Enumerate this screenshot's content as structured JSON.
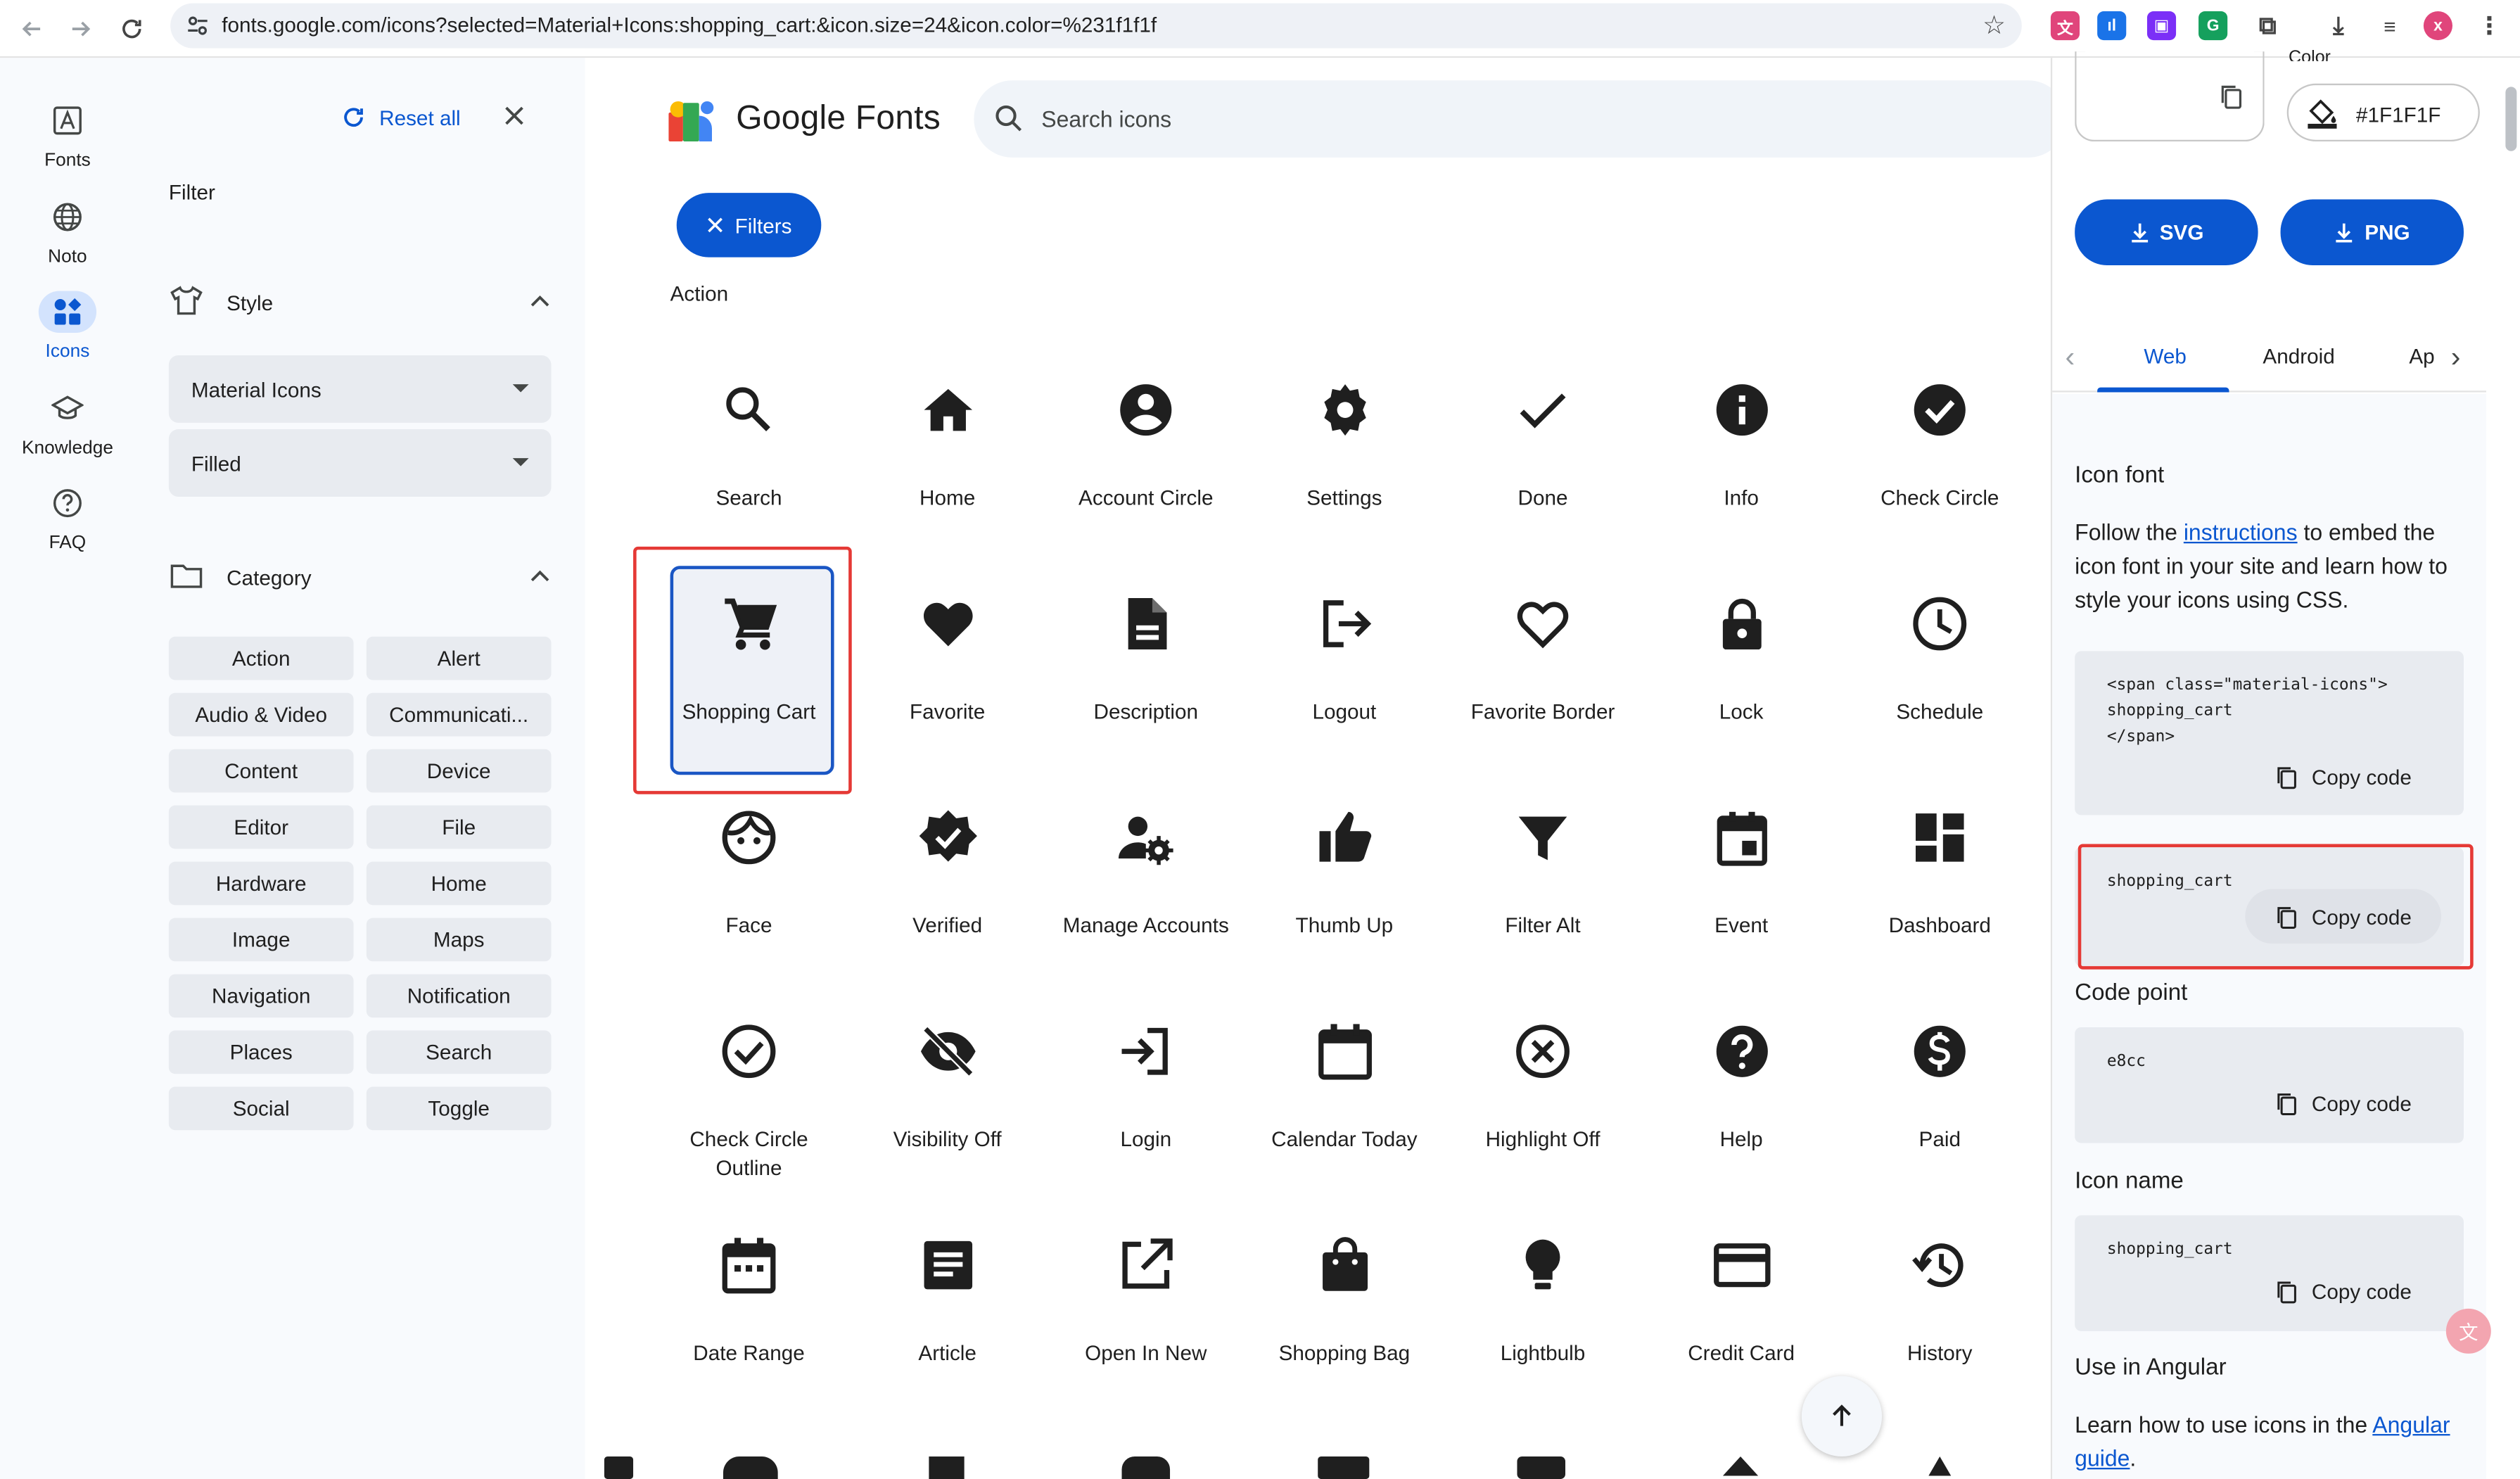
{
  "browser": {
    "url": "fonts.google.com/icons?selected=Material+Icons:shopping_cart:&icon.size=24&icon.color=%231f1f1f",
    "extensions": [
      {
        "name": "translate-extension-icon",
        "color": "#e0457b",
        "glyph": "文"
      },
      {
        "name": "analytics-extension-icon",
        "color": "#1a73e8",
        "glyph": "ıl"
      },
      {
        "name": "twitch-extension-icon",
        "color": "#7b2ff7",
        "glyph": "▣"
      },
      {
        "name": "grammarly-extension-icon",
        "color": "#15a05d",
        "glyph": "G"
      }
    ],
    "profile_initial": "x"
  },
  "rail": {
    "items": [
      {
        "label": "Fonts",
        "icon": "fonts-icon"
      },
      {
        "label": "Noto",
        "icon": "globe-icon"
      },
      {
        "label": "Icons",
        "icon": "icons-icon",
        "active": true
      },
      {
        "label": "Knowledge",
        "icon": "graduation-cap-icon"
      },
      {
        "label": "FAQ",
        "icon": "help-circle-icon"
      }
    ]
  },
  "filter": {
    "reset_label": "Reset all",
    "title": "Filter",
    "style_heading": "Style",
    "style_select": "Material Icons",
    "variant_select": "Filled",
    "category_heading": "Category",
    "categories": [
      "Action",
      "Alert",
      "Audio & Video",
      "Communicati...",
      "Content",
      "Device",
      "Editor",
      "File",
      "Hardware",
      "Home",
      "Image",
      "Maps",
      "Navigation",
      "Notification",
      "Places",
      "Search",
      "Social",
      "Toggle"
    ]
  },
  "main": {
    "brand": "Google Fonts",
    "search_placeholder": "Search icons",
    "filters_label": "Filters",
    "category_title": "Action",
    "icons": [
      {
        "label": "Search",
        "icon": "search"
      },
      {
        "label": "Home",
        "icon": "home"
      },
      {
        "label": "Account Circle",
        "icon": "account_circle"
      },
      {
        "label": "Settings",
        "icon": "settings"
      },
      {
        "label": "Done",
        "icon": "done"
      },
      {
        "label": "Info",
        "icon": "info"
      },
      {
        "label": "Check Circle",
        "icon": "check_circle"
      },
      {
        "label": "Shopping Cart",
        "icon": "shopping_cart",
        "selected": true
      },
      {
        "label": "Favorite",
        "icon": "favorite"
      },
      {
        "label": "Description",
        "icon": "description"
      },
      {
        "label": "Logout",
        "icon": "logout"
      },
      {
        "label": "Favorite Border",
        "icon": "favorite_border"
      },
      {
        "label": "Lock",
        "icon": "lock"
      },
      {
        "label": "Schedule",
        "icon": "schedule"
      },
      {
        "label": "Face",
        "icon": "face"
      },
      {
        "label": "Verified",
        "icon": "verified"
      },
      {
        "label": "Manage Accounts",
        "icon": "manage_accounts"
      },
      {
        "label": "Thumb Up",
        "icon": "thumb_up"
      },
      {
        "label": "Filter Alt",
        "icon": "filter_alt"
      },
      {
        "label": "Event",
        "icon": "event"
      },
      {
        "label": "Dashboard",
        "icon": "dashboard"
      },
      {
        "label": "Check Circle Outline",
        "icon": "check_circle_outline"
      },
      {
        "label": "Visibility Off",
        "icon": "visibility_off"
      },
      {
        "label": "Login",
        "icon": "login"
      },
      {
        "label": "Calendar Today",
        "icon": "calendar_today"
      },
      {
        "label": "Highlight Off",
        "icon": "highlight_off"
      },
      {
        "label": "Help",
        "icon": "help"
      },
      {
        "label": "Paid",
        "icon": "paid"
      },
      {
        "label": "Date Range",
        "icon": "date_range"
      },
      {
        "label": "Article",
        "icon": "article"
      },
      {
        "label": "Open In New",
        "icon": "open_in_new"
      },
      {
        "label": "Shopping Bag",
        "icon": "shopping_bag"
      },
      {
        "label": "Lightbulb",
        "icon": "lightbulb"
      },
      {
        "label": "Credit Card",
        "icon": "credit_card"
      },
      {
        "label": "History",
        "icon": "history"
      }
    ]
  },
  "panel": {
    "color_label": "Color",
    "color_value": "#1F1F1F",
    "svg_label": "SVG",
    "png_label": "PNG",
    "tabs": [
      "Web",
      "Android",
      "Ap"
    ],
    "icon_font_heading": "Icon font",
    "icon_font_text_before": "Follow the ",
    "icon_font_link": "instructions",
    "icon_font_text_after": " to embed the icon font in your site and learn how to style your icons using CSS.",
    "span_code": "<span class=\"material-icons\">\nshopping_cart\n</span>",
    "ligature_code": "shopping_cart",
    "copy_label": "Copy code",
    "code_point_heading": "Code point",
    "code_point": "e8cc",
    "icon_name_heading": "Icon name",
    "icon_name": "shopping_cart",
    "angular_heading": "Use in Angular",
    "angular_text_before": "Learn how to use icons in the ",
    "angular_link": "Angular guide",
    "angular_text_after": "."
  },
  "colors": {
    "accent": "#0b57d0",
    "highlight": "#e53935",
    "icon": "#1f1f1f"
  }
}
